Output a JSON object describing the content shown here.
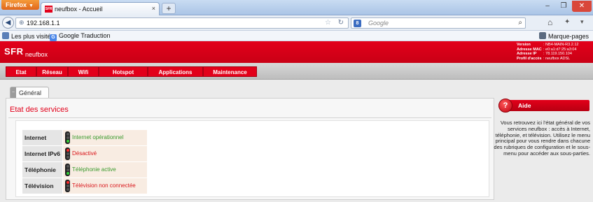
{
  "browser": {
    "menu_button": "Firefox",
    "tab_title": "neufbox - Accueil",
    "tab_favicon": "SFR",
    "url": "192.168.1.1",
    "search_placeholder": "Google",
    "search_engine_letter": "8",
    "bookmarks": [
      "Les plus visités",
      "Google Traduction"
    ],
    "bookmarks_right": "Marque-pages"
  },
  "header": {
    "logo": "SFR",
    "product": "neufbox",
    "info": [
      {
        "key": "Version",
        "value": ": NB4-MAIN-R3.2.12"
      },
      {
        "key": "Adresse MAC",
        "value": ": e0:a1:d7:25:a3:04"
      },
      {
        "key": "Adresse IP",
        "value": ": 78.119.150.104"
      },
      {
        "key": "Profil d'accès",
        "value": ": neufbox ADSL"
      }
    ]
  },
  "nav": [
    "Etat",
    "Réseau",
    "Wifi",
    "Hotspot",
    "Applications",
    "Maintenance"
  ],
  "section_tab": "Général",
  "panel": {
    "title": "Etat des services",
    "services": [
      {
        "label": "Internet",
        "status": "Internet opérationnel",
        "state": "ok"
      },
      {
        "label": "Internet IPv6",
        "status": "Désactivé",
        "state": "ko"
      },
      {
        "label": "Téléphonie",
        "status": "Téléphonie active",
        "state": "ok"
      },
      {
        "label": "Télévision",
        "status": "Télévision non connectée",
        "state": "ko"
      }
    ]
  },
  "help": {
    "title": "Aide",
    "text": "Vous retrouvez ici l'état général de vos services neufbox : accès à Internet, téléphonie, et télévision. Utilisez le menu principal pour vous rendre dans chacune des rubriques de configuration et le sous-menu pour accéder aux sous-parties."
  },
  "colors": {
    "brand_red": "#e2001a",
    "status_ok": "#3a9a2d",
    "status_ko": "#d9171b"
  }
}
